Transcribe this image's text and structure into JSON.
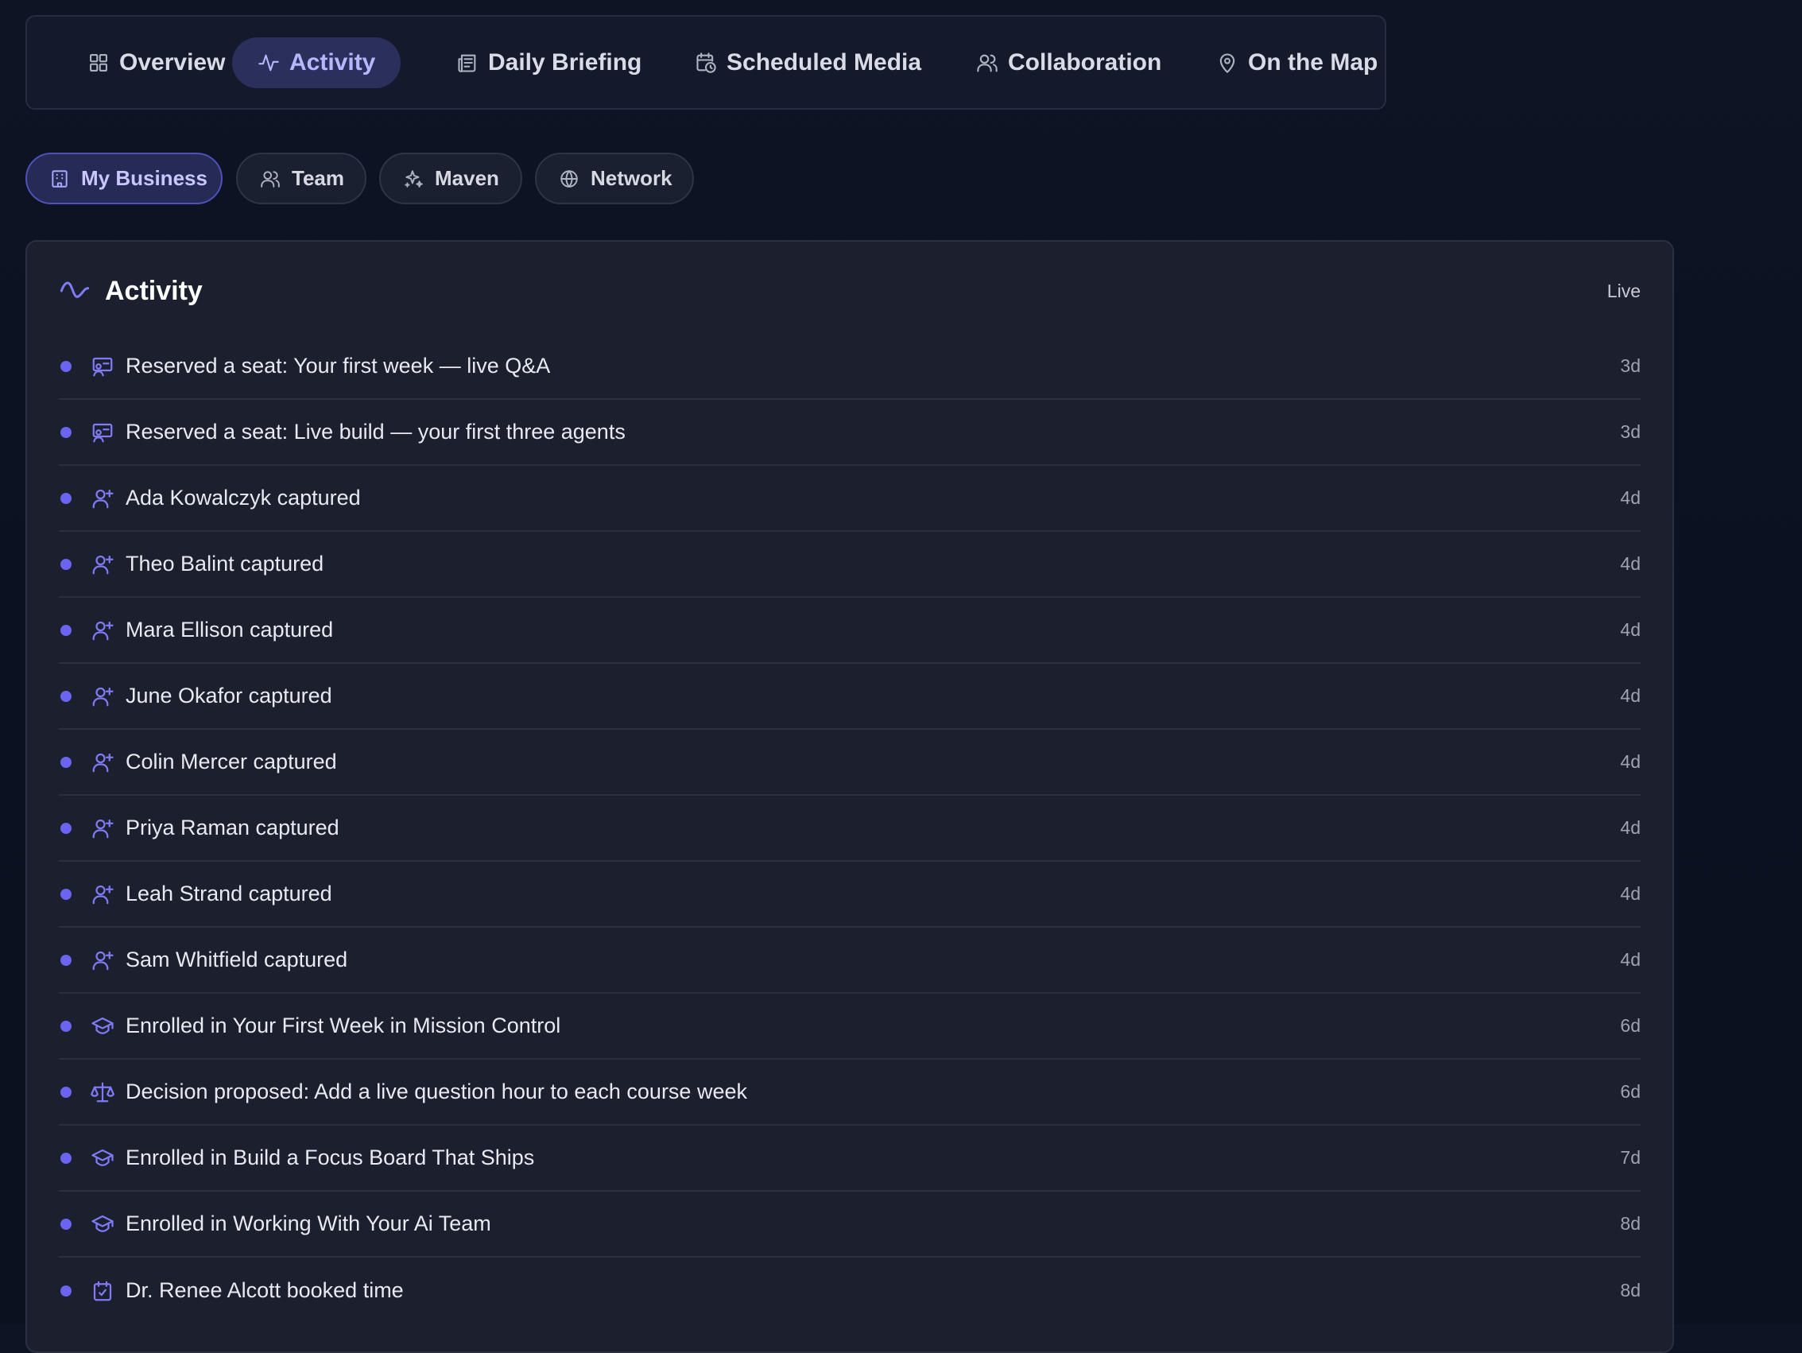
{
  "tabs": [
    {
      "label": "Overview",
      "icon": "grid-icon"
    },
    {
      "label": "Activity",
      "icon": "pulse-icon",
      "active": true
    },
    {
      "label": "Daily Briefing",
      "icon": "newspaper-icon"
    },
    {
      "label": "Scheduled Media",
      "icon": "calendar-clock-icon"
    },
    {
      "label": "Collaboration",
      "icon": "users-icon"
    },
    {
      "label": "On the Map",
      "icon": "map-pin-icon"
    }
  ],
  "scopes": [
    {
      "label": "My Business",
      "icon": "building-icon",
      "active": true
    },
    {
      "label": "Team",
      "icon": "users-icon"
    },
    {
      "label": "Maven",
      "icon": "sparkles-icon"
    },
    {
      "label": "Network",
      "icon": "globe-icon"
    }
  ],
  "panel": {
    "title": "Activity",
    "status": "Live",
    "icon": "wave-icon"
  },
  "activity": [
    {
      "icon": "presentation-icon",
      "text": "Reserved a seat: Your first week — live Q&A",
      "time": "3d"
    },
    {
      "icon": "presentation-icon",
      "text": "Reserved a seat: Live build — your first three agents",
      "time": "3d"
    },
    {
      "icon": "user-plus-icon",
      "text": "Ada Kowalczyk captured",
      "time": "4d"
    },
    {
      "icon": "user-plus-icon",
      "text": "Theo Balint captured",
      "time": "4d"
    },
    {
      "icon": "user-plus-icon",
      "text": "Mara Ellison captured",
      "time": "4d"
    },
    {
      "icon": "user-plus-icon",
      "text": "June Okafor captured",
      "time": "4d"
    },
    {
      "icon": "user-plus-icon",
      "text": "Colin Mercer captured",
      "time": "4d"
    },
    {
      "icon": "user-plus-icon",
      "text": "Priya Raman captured",
      "time": "4d"
    },
    {
      "icon": "user-plus-icon",
      "text": "Leah Strand captured",
      "time": "4d"
    },
    {
      "icon": "user-plus-icon",
      "text": "Sam Whitfield captured",
      "time": "4d"
    },
    {
      "icon": "graduation-cap-icon",
      "text": "Enrolled in Your First Week in Mission Control",
      "time": "6d"
    },
    {
      "icon": "scale-icon",
      "text": "Decision proposed: Add a live question hour to each course week",
      "time": "6d"
    },
    {
      "icon": "graduation-cap-icon",
      "text": "Enrolled in Build a Focus Board That Ships",
      "time": "7d"
    },
    {
      "icon": "graduation-cap-icon",
      "text": "Enrolled in Working With Your Ai Team",
      "time": "8d"
    },
    {
      "icon": "calendar-check-icon",
      "text": "Dr. Renee Alcott booked time",
      "time": "8d"
    }
  ],
  "colors": {
    "accent": "#6a64f0",
    "active_tab_bg": "#2a2f5c",
    "panel_bg": "#1b1f2e"
  }
}
